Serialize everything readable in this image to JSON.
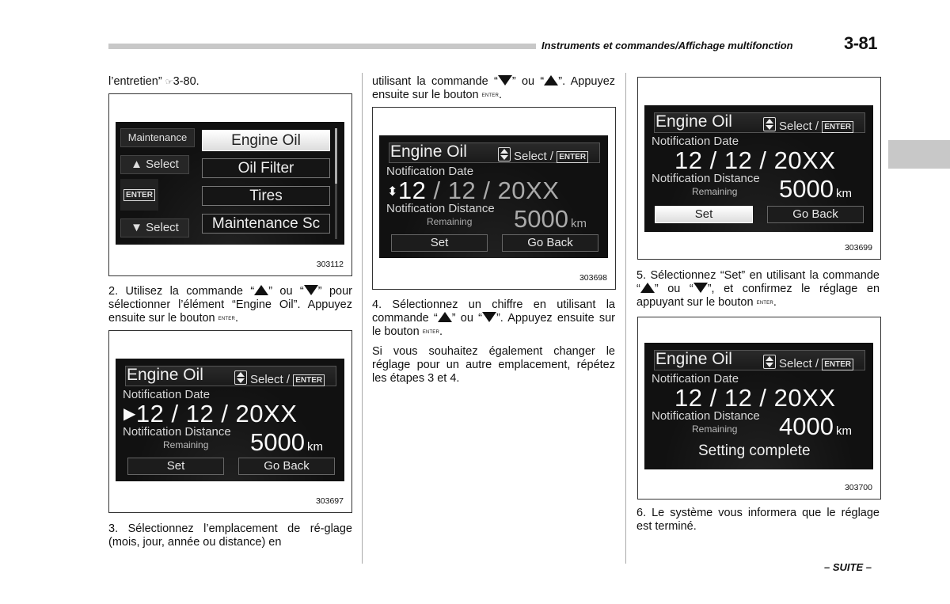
{
  "header": {
    "section_title": "Instruments et commandes/Affichage multifonction",
    "page_number": "3-81"
  },
  "footer": {
    "continue_label": "– SUITE –"
  },
  "column1": {
    "intro_text": "l’entretien”",
    "intro_ref_icon": "pointing-hand-icon",
    "intro_ref": "3-80.",
    "step2": {
      "pre": "2. Utilisez la commande “",
      "mid": "” ou “",
      "post": "” pour sélectionner l’élément “Engine Oil”. Appuyez ensuite sur le bouton",
      "button": "ENTER",
      "end": "."
    },
    "step3": "3. Sélectionnez l’emplacement de ré-glage (mois, jour, année ou distance) en"
  },
  "column2": {
    "cont": {
      "pre": "utilisant la commande “",
      "mid": "” ou “",
      "post": "”. Appuyez ensuite sur le bouton",
      "button": "ENTER",
      "end": "."
    },
    "step4": {
      "pre": "4. Sélectionnez un chiffre en utilisant la commande “",
      "mid": "” ou “",
      "post": "”. Appuyez ensuite sur le bouton",
      "button": "ENTER",
      "end": "."
    },
    "note": "Si vous souhaitez également changer le réglage pour un autre emplacement, répétez les étapes 3 et 4."
  },
  "column3": {
    "step5": {
      "pre": "5. Sélectionnez “Set” en utilisant la commande “",
      "mid": "” ou “",
      "post": "”, et confirmez le réglage en appuyant sur le bouton",
      "button": "ENTER",
      "end": "."
    },
    "step6": "6. Le système vous informera que le réglage est terminé."
  },
  "figures": {
    "fig1": {
      "number": "303112",
      "left_menu": [
        "Maintenance",
        "Select",
        "ENTER",
        "Select"
      ],
      "items": [
        "Engine Oil",
        "Oil Filter",
        "Tires",
        "Maintenance Sc"
      ],
      "selected": "Engine Oil"
    },
    "common": {
      "title": "Engine Oil",
      "select_label": "Select /",
      "enter_label": "ENTER",
      "date_label": "Notification Date",
      "distance_label": "Notification Distance",
      "remaining_label": "Remaining",
      "km_unit": "km",
      "set_label": "Set",
      "goback_label": "Go Back"
    },
    "fig2": {
      "number": "303697",
      "date": [
        "12",
        "12",
        "20XX"
      ],
      "distance": "5000",
      "cursor": "month",
      "cursor_icon": "right-triangle-icon"
    },
    "fig3": {
      "number": "303698",
      "date": [
        "12",
        "12",
        "20XX"
      ],
      "distance": "5000",
      "cursor": "month",
      "cursor_icon": "up-down-arrows-icon"
    },
    "fig4": {
      "number": "303699",
      "date": [
        "12",
        "12",
        "20XX"
      ],
      "distance": "5000",
      "selected_button": "Set"
    },
    "fig5": {
      "number": "303700",
      "date": [
        "12",
        "12",
        "20XX"
      ],
      "distance": "4000",
      "message": "Setting complete"
    }
  }
}
